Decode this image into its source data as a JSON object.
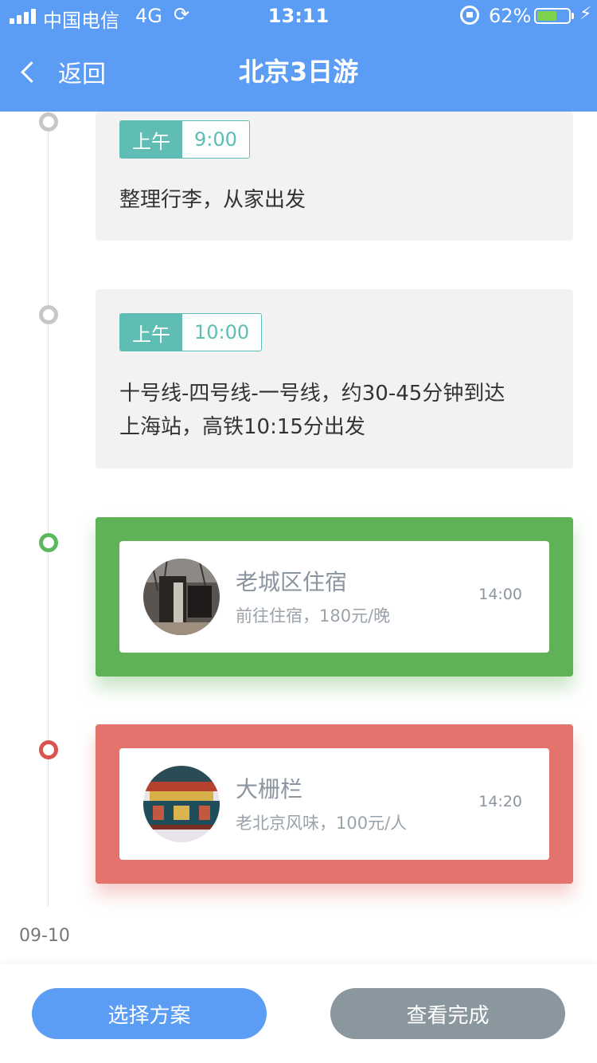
{
  "status_bar": {
    "carrier": "中国电信",
    "network": "4G",
    "time": "13:11",
    "battery_percent": "62%",
    "battery_level": 0.62,
    "battery_color": "#7fd24b"
  },
  "nav": {
    "back_label": "返回",
    "title": "北京3日游",
    "color": "#5b9cf5"
  },
  "timeline": [
    {
      "period": "上午",
      "time": "9:00",
      "description": "整理行李，从家出发"
    },
    {
      "period": "上午",
      "time": "10:00",
      "description_lines": [
        "十号线-四号线-一号线，约30-45分钟到达",
        "上海站，高铁10:15分出发"
      ]
    }
  ],
  "places": [
    {
      "name": "老城区住宿",
      "detail": "前往住宿，180元/晚",
      "time": "14:00",
      "accent": "#5fb257"
    },
    {
      "name": "大栅栏",
      "detail": "老北京风味，100元/人",
      "time": "14:20",
      "accent": "#e4736e"
    }
  ],
  "date_label": "09-10",
  "buttons": {
    "select_plan": "选择方案",
    "view_done": "查看完成"
  },
  "icons": {
    "back": "chevron-left-icon",
    "sync": "sync-icon",
    "orientation_lock": "lock-rotation-icon",
    "charging": "bolt-icon"
  }
}
